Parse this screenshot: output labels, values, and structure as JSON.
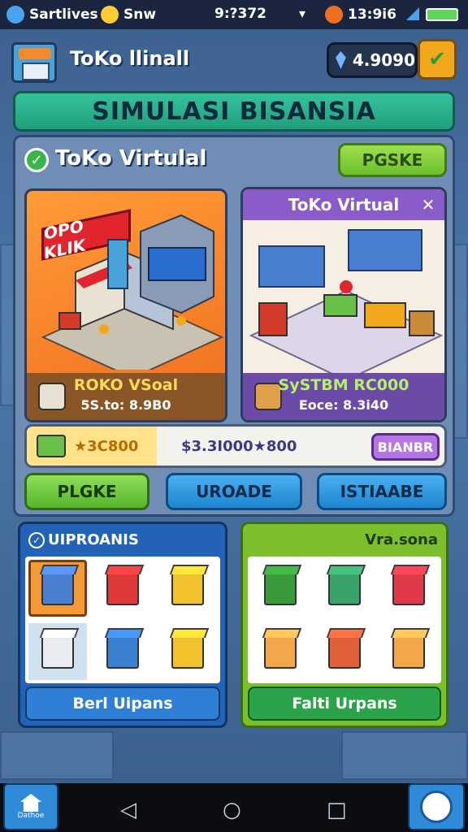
{
  "status_bar": {
    "left_label": "Sartlives",
    "mid_label": "Snw",
    "time": "9:?372",
    "right_time": "13:9i6"
  },
  "header": {
    "shop_title": "ToKo llinall",
    "coins": "4.9090"
  },
  "banner": {
    "title": "SIMULASI BISANSIA"
  },
  "panel": {
    "title": "ToKo Virtulal",
    "action_label": "PGSKE"
  },
  "card_left": {
    "sign_text": "OPO KLIK",
    "footer_title": "ROKO VSoal",
    "footer_sub": "5S.to: 8.9B0"
  },
  "card_right": {
    "header_title": "ToKo Virtual",
    "footer_title": "SySTBM RC000",
    "footer_sub": "Eoce: 8.3i40"
  },
  "resources": {
    "value_left": "★3C800",
    "value_right": "$3.3I000★800",
    "button_label": "BIANBR"
  },
  "actions": [
    {
      "label": "PLGKE"
    },
    {
      "label": "UROADE"
    },
    {
      "label": "ISTIAABE"
    }
  ],
  "bottom_left": {
    "header": "UIPROANIS",
    "button_label": "Berl Uipans"
  },
  "bottom_right": {
    "header": "Vra.sona",
    "button_label": "Falti Urpans"
  },
  "nav": {
    "home_label": "Dathoe"
  },
  "colors": {
    "banner": "#1f9f7c",
    "accent_orange": "#f06e1f",
    "accent_purple": "#8a5cc9",
    "accent_blue": "#1e86d2",
    "accent_green": "#57b42c"
  }
}
